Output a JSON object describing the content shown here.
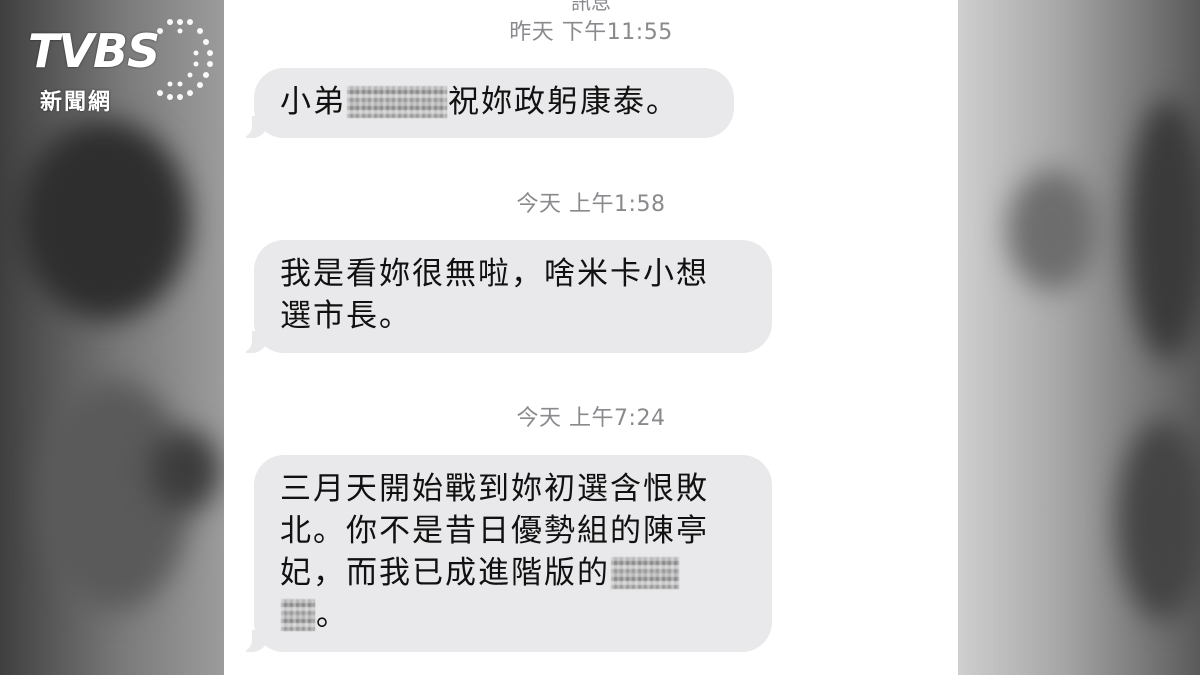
{
  "logo": {
    "main": "TVBS",
    "sub": "新聞網"
  },
  "thread": {
    "header_peek": "訊息",
    "timestamps": [
      "昨天 下午11:55",
      "今天 上午1:58",
      "今天 上午7:24"
    ],
    "messages": [
      {
        "lines": [
          [
            "小弟",
            "[redacted]",
            "祝妳政躬康泰。"
          ]
        ]
      },
      {
        "lines": [
          [
            "我是看妳很無啦，啥米卡小想"
          ],
          [
            "選市長。"
          ]
        ]
      },
      {
        "lines": [
          [
            "三月天開始戰到妳初選含恨敗"
          ],
          [
            "北。你不是昔日優勢組的陳亭"
          ],
          [
            "妃，而我已成進階版的",
            "[redacted]"
          ],
          [
            "[redacted]",
            "。"
          ]
        ]
      }
    ]
  },
  "colors": {
    "bubble": "#e9e9eb",
    "timestamp": "#8a8a8e",
    "text": "#111111"
  },
  "icons": [
    "tvbs-logo-icon",
    "redaction-mosaic-icon"
  ]
}
